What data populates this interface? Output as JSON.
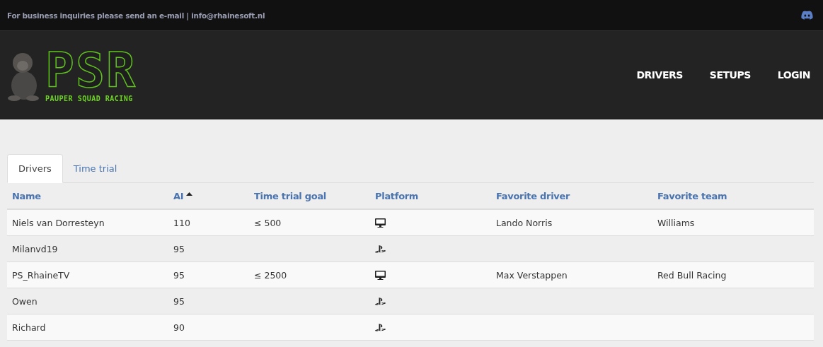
{
  "top_bar": {
    "notice": "For business inquiries please send an e-mail | info@rhainesoft.nl"
  },
  "header": {
    "logo": {
      "letters": "PSR",
      "tagline": "PAUPER SQUAD RACING"
    },
    "nav": [
      {
        "label": "DRIVERS"
      },
      {
        "label": "SETUPS"
      },
      {
        "label": "LOGIN"
      }
    ]
  },
  "tabs": [
    {
      "label": "Drivers",
      "selected": true
    },
    {
      "label": "Time trial",
      "selected": false
    }
  ],
  "table": {
    "columns": [
      {
        "label": "Name",
        "sorted_ascending": false
      },
      {
        "label": "AI",
        "sorted_ascending": true
      },
      {
        "label": "Time trial goal",
        "sorted_ascending": false
      },
      {
        "label": "Platform",
        "sorted_ascending": false
      },
      {
        "label": "Favorite driver",
        "sorted_ascending": false
      },
      {
        "label": "Favorite team",
        "sorted_ascending": false
      }
    ],
    "rows": [
      {
        "name": "Niels van Dorresteyn",
        "ai": "110",
        "goal": "≤ 500",
        "platform": {
          "kind": "pc"
        },
        "favorite_driver": "Lando Norris",
        "favorite_team": "Williams"
      },
      {
        "name": "Milanvd19",
        "ai": "95",
        "platform": {
          "kind": "playstation"
        }
      },
      {
        "name": "PS_RhaineTV",
        "ai": "95",
        "goal": "≤ 2500",
        "platform": {
          "kind": "pc"
        },
        "favorite_driver": "Max Verstappen",
        "favorite_team": "Red Bull Racing"
      },
      {
        "name": "Owen",
        "ai": "95",
        "platform": {
          "kind": "playstation"
        }
      },
      {
        "name": "Richard",
        "ai": "90",
        "platform": {
          "kind": "playstation"
        }
      }
    ]
  }
}
